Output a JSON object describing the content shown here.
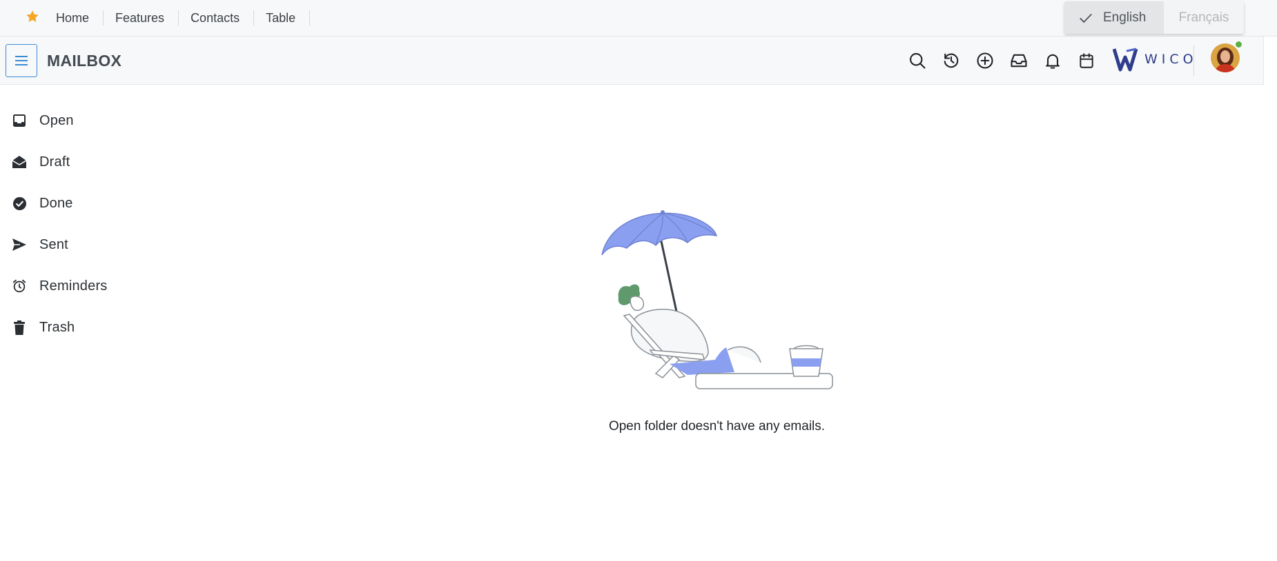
{
  "topnav": {
    "links": [
      "Home",
      "Features",
      "Contacts",
      "Table"
    ]
  },
  "language": {
    "selected": "English",
    "other": "Français"
  },
  "header": {
    "title": "MAILBOX",
    "icons": [
      "search-icon",
      "history-icon",
      "add-icon",
      "inbox-icon",
      "bell-icon",
      "calendar-icon"
    ],
    "logo_text": "WICO"
  },
  "sidebar": {
    "items": [
      {
        "label": "Open",
        "icon": "inbox-tray-icon"
      },
      {
        "label": "Draft",
        "icon": "envelope-open-icon"
      },
      {
        "label": "Done",
        "icon": "check-circle-icon"
      },
      {
        "label": "Sent",
        "icon": "send-icon"
      },
      {
        "label": "Reminders",
        "icon": "alarm-clock-icon"
      },
      {
        "label": "Trash",
        "icon": "trash-icon"
      }
    ]
  },
  "main": {
    "empty_message": "Open folder doesn't have any emails."
  },
  "colors": {
    "accent": "#3a8bd6",
    "star": "#f5a623",
    "online": "#5bb044",
    "illustration": "#8b9ff0"
  }
}
